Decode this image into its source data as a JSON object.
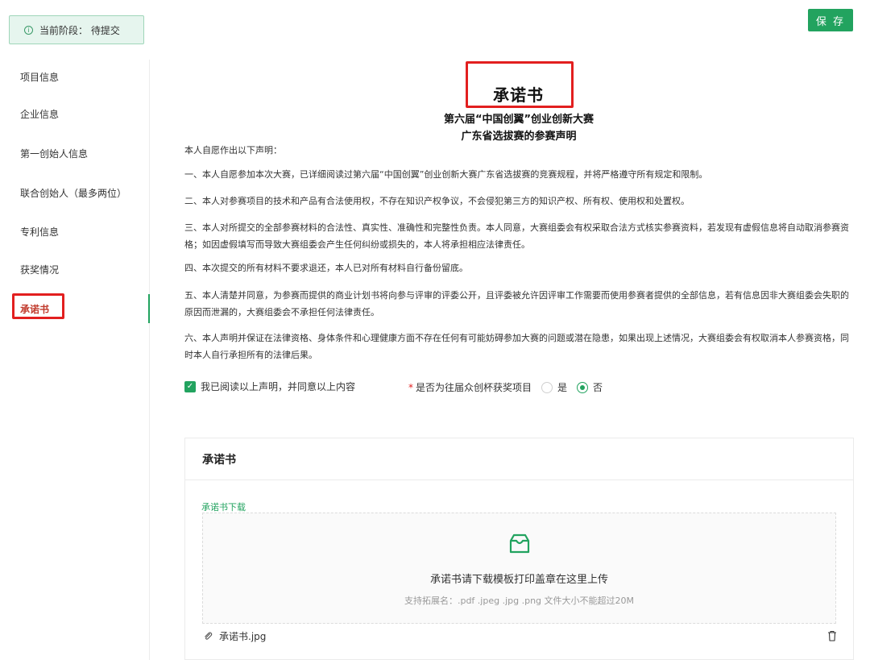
{
  "header": {
    "stage_icon": "info-icon",
    "stage_text": "当前阶段： 待提交",
    "save_label": "保 存"
  },
  "sidebar": {
    "items": [
      {
        "label": "项目信息"
      },
      {
        "label": "企业信息"
      },
      {
        "label": "第一创始人信息"
      },
      {
        "label": "联合创始人（最多两位）"
      },
      {
        "label": "专利信息"
      },
      {
        "label": "获奖情况"
      },
      {
        "label": "承诺书",
        "active": true
      }
    ]
  },
  "document": {
    "title": "承诺书",
    "subtitle_1": "第六届“中国创翼”创业创新大赛",
    "subtitle_2": "广东省选拔赛的参赛声明",
    "paragraphs": [
      "本人自愿作出以下声明：",
      "一、本人自愿参加本次大赛，已详细阅读过第六届“中国创翼”创业创新大赛广东省选拔赛的竞赛规程，并将严格遵守所有规定和限制。",
      "二、本人对参赛项目的技术和产品有合法使用权，不存在知识产权争议，不会侵犯第三方的知识产权、所有权、使用权和处置权。",
      "三、本人对所提交的全部参赛材料的合法性、真实性、准确性和完整性负责。本人同意，大赛组委会有权采取合法方式核实参赛资料，若发现有虚假信息将自动取消参赛资格；如因虚假填写而导致大赛组委会产生任何纠纷或损失的，本人将承担相应法律责任。",
      "四、本次提交的所有材料不要求退还，本人已对所有材料自行备份留底。",
      "五、本人清楚并同意，为参赛而提供的商业计划书将向参与评审的评委公开，且评委被允许因评审工作需要而使用参赛者提供的全部信息，若有信息因非大赛组委会失职的原因而泄漏的，大赛组委会不承担任何法律责任。",
      "六、本人声明并保证在法律资格、身体条件和心理健康方面不存在任何有可能妨碍参加大赛的问题或潜在隐患，如果出现上述情况，大赛组委会有权取消本人参赛资格，同时本人自行承担所有的法律后果。"
    ],
    "agree_label": "我已阅读以上声明，并同意以上内容",
    "agree_checked": true,
    "award_question": "是否为往届众创杯获奖项目",
    "award_required_mark": "*",
    "award_options": [
      {
        "label": "是",
        "checked": false
      },
      {
        "label": "否",
        "checked": true
      }
    ]
  },
  "upload_card": {
    "title": "承诺书",
    "download_link": "承诺书下载",
    "dropzone_icon": "inbox-icon",
    "dropzone_text": "承诺书请下载模板打印盖章在这里上传",
    "dropzone_hint": "支持拓展名：.pdf .jpeg .jpg .png 文件大小不能超过20M",
    "file_icon": "paperclip-icon",
    "file_name": "承诺书.jpg",
    "delete_icon": "trash-icon"
  },
  "colors": {
    "accent": "#22a35f",
    "highlight": "#e21f1f"
  }
}
